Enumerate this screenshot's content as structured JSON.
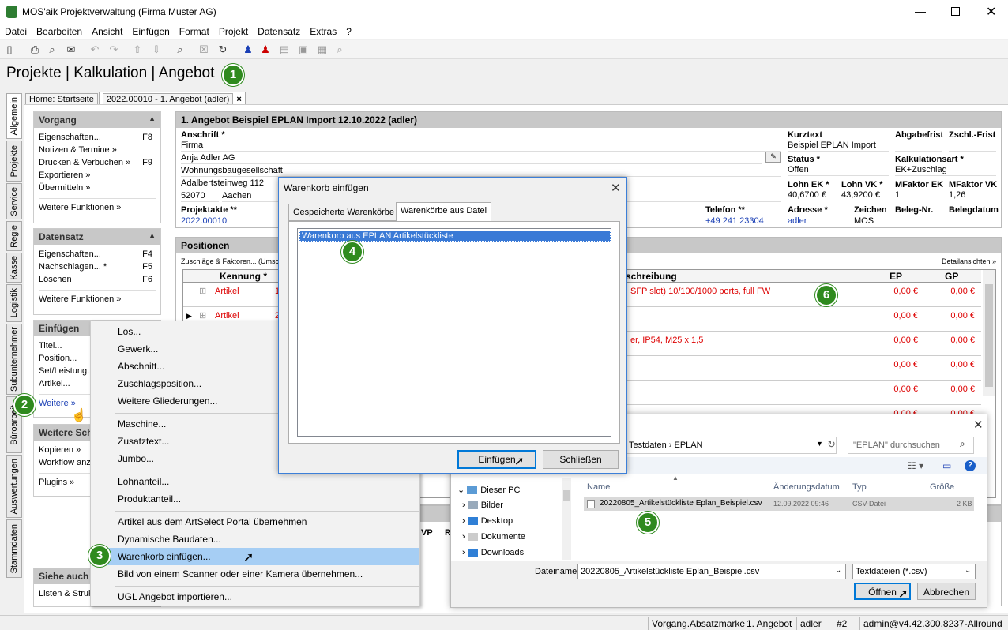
{
  "window": {
    "title": "MOS'aik Projektverwaltung (Firma Muster AG)"
  },
  "menubar": [
    "Datei",
    "Bearbeiten",
    "Ansicht",
    "Einfügen",
    "Format",
    "Projekt",
    "Datensatz",
    "Extras",
    "?"
  ],
  "heading": "Projekte | Kalkulation | Angebot",
  "badges": [
    "1",
    "2",
    "3",
    "4",
    "5",
    "6"
  ],
  "vtabs": [
    "Allgemein",
    "Projekte",
    "Service",
    "Regie",
    "Kasse",
    "Logistik",
    "Subunternehmer",
    "Büroarbeit",
    "Auswertungen",
    "Stammdaten"
  ],
  "doc_tabs": [
    "Home: Startseite",
    "2022.00010 - 1. Angebot (adler)"
  ],
  "tab_close": "×",
  "vorgang": {
    "title": "Vorgang",
    "items": [
      {
        "label": "Eigenschaften...",
        "key": "F8"
      },
      {
        "label": "Notizen & Termine »",
        "key": ""
      },
      {
        "label": "Drucken & Verbuchen »",
        "key": "F9"
      },
      {
        "label": "Exportieren »",
        "key": ""
      },
      {
        "label": "Übermitteln »",
        "key": ""
      }
    ],
    "more": "Weitere Funktionen »"
  },
  "datensatz": {
    "title": "Datensatz",
    "items": [
      {
        "label": "Eigenschaften...",
        "key": "F4"
      },
      {
        "label": "Nachschlagen... *",
        "key": "F5"
      },
      {
        "label": "Löschen",
        "key": "F6"
      }
    ],
    "more": "Weitere Funktionen »"
  },
  "einfuegen": {
    "title": "Einfügen",
    "items": [
      "Titel...",
      "Position...",
      "Set/Leistung...",
      "Artikel..."
    ],
    "more": "Weitere »"
  },
  "weitere": {
    "title": "Weitere Schritte",
    "items": [
      "Kopieren »",
      "Workflow anzeigen",
      "Plugins »"
    ]
  },
  "siehe": {
    "title": "Siehe auch",
    "items": [
      "Listen & Strukturen"
    ]
  },
  "angebot": {
    "title": "1. Angebot Beispiel EPLAN Import 12.10.2022 (adler)",
    "anschrift_label": "Anschrift *",
    "anschrift": [
      "Firma",
      "Anja Adler AG",
      "Wohnungsbaugesellschaft",
      "Adalbertsteinweg 112"
    ],
    "plz": "52070",
    "ort": "Aachen",
    "projektakte_label": "Projektakte **",
    "projektakte": "2022.00010",
    "telefon_label": "Telefon **",
    "telefon": "+49 241 23304",
    "kurztext_label": "Kurztext",
    "kurztext": "Beispiel EPLAN Import",
    "abgabefrist_label": "Abgabefrist",
    "zschl_label": "Zschl.-Frist",
    "status_label": "Status *",
    "status": "Offen",
    "kalk_label": "Kalkulationsart *",
    "kalk": "EK+Zuschlag",
    "lohnek_label": "Lohn EK *",
    "lohnek": "40,6700 €",
    "lohnvk_label": "Lohn VK *",
    "lohnvk": "43,9200 €",
    "mfek_label": "MFaktor EK",
    "mfek": "1",
    "mfvk_label": "MFaktor VK",
    "mfvk": "1,26",
    "adresse_label": "Adresse *",
    "adresse": "adler",
    "zeichen_label": "Zeichen",
    "zeichen": "MOS",
    "belegnr_label": "Beleg-Nr.",
    "belegdatum_label": "Belegdatum"
  },
  "positionen": {
    "title": "Positionen",
    "zuschlaege": "Zuschläge & Faktoren... (Umsch...",
    "detail": "Detailansichten »",
    "col_kennung": "Kennung *",
    "col_beschreibung": "schreibung",
    "col_ep": "EP",
    "col_gp": "GP",
    "rows": [
      {
        "kennung": "Artikel",
        "nr": "1",
        "text": "SFP slot) 10/100/1000 ports, full FW",
        "ep": "0,00 €",
        "gp": "0,00 €"
      },
      {
        "kennung": "Artikel",
        "nr": "2",
        "text": "",
        "ep": "0,00 €",
        "gp": "0,00 €"
      },
      {
        "kennung": "",
        "nr": "",
        "text": "er, IP54, M25 x 1,5",
        "ep": "0,00 €",
        "gp": "0,00 €"
      },
      {
        "kennung": "",
        "nr": "",
        "text": "",
        "ep": "0,00 €",
        "gp": "0,00 €"
      },
      {
        "kennung": "",
        "nr": "",
        "text": "",
        "ep": "0,00 €",
        "gp": "0,00 €"
      },
      {
        "kennung": "",
        "nr": "",
        "text": "",
        "ep": "0,00 €",
        "gp": "0,00 €"
      }
    ],
    "lower_cols": [
      "VP",
      "R"
    ]
  },
  "context_menu": [
    "Los...",
    "Gewerk...",
    "Abschnitt...",
    "Zuschlagsposition...",
    "Weitere Gliederungen...",
    "Maschine...",
    "Zusatztext...",
    "Jumbo...",
    "Lohnanteil...",
    "Produktanteil...",
    "Artikel aus dem ArtSelect Portal übernehmen",
    "Dynamische Baudaten...",
    "Warenkorb einfügen...",
    "Bild von einem Scanner oder einer Kamera übernehmen...",
    "UGL Angebot importieren..."
  ],
  "warenkorb_dialog": {
    "title": "Warenkorb einfügen",
    "tabs": [
      "Gespeicherte Warenkörbe",
      "Warenkörbe aus Datei"
    ],
    "selected": "Warenkorb aus EPLAN Artikelstückliste",
    "insert": "Einfügen",
    "close": "Schließen"
  },
  "file_dialog": {
    "path": [
      "Testdaten",
      "EPLAN"
    ],
    "search_placeholder": "\"EPLAN\" durchsuchen",
    "tree": [
      "Dieser PC",
      "Bilder",
      "Desktop",
      "Dokumente",
      "Downloads"
    ],
    "cols": [
      "Name",
      "Änderungsdatum",
      "Typ",
      "Größe"
    ],
    "file": {
      "name": "20220805_Artikelstückliste Eplan_Beispiel.csv",
      "date": "12.09.2022 09:46",
      "type": "CSV-Datei",
      "size": "2 KB"
    },
    "filename_label": "Dateiname:",
    "filename": "20220805_Artikelstückliste Eplan_Beispiel.csv",
    "filter": "Textdateien (*.csv)",
    "open": "Öffnen",
    "cancel": "Abbrechen"
  },
  "statusbar": [
    "Vorgang.Absatzmarke",
    "1. Angebot",
    "adler",
    "#2",
    "admin@v4.42.300.8237-Allround"
  ]
}
